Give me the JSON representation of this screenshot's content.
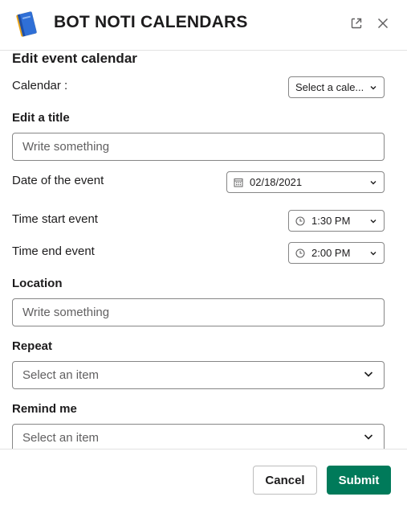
{
  "header": {
    "app_title": "BOT NOTI CALENDARS",
    "app_icon": "notebook-icon",
    "popout_icon": "external-link-icon",
    "close_icon": "close-icon"
  },
  "form": {
    "section_title": "Edit event calendar",
    "calendar": {
      "label": "Calendar :",
      "value": "Select a cale..."
    },
    "title": {
      "label": "Edit a title",
      "placeholder": "Write something"
    },
    "date": {
      "label": "Date of the event",
      "value": "02/18/2021",
      "icon": "calendar-icon"
    },
    "time_start": {
      "label": "Time start event",
      "value": "1:30 PM",
      "icon": "clock-icon"
    },
    "time_end": {
      "label": "Time end event",
      "value": "2:00 PM",
      "icon": "clock-icon"
    },
    "location": {
      "label": "Location",
      "placeholder": "Write something"
    },
    "repeat": {
      "label": "Repeat",
      "value": "Select an item"
    },
    "remind": {
      "label": "Remind me",
      "value": "Select an item"
    }
  },
  "footer": {
    "cancel_label": "Cancel",
    "submit_label": "Submit"
  },
  "colors": {
    "submit_bg": "#007a5a",
    "text": "#1d1c1d",
    "border": "#868686",
    "placeholder": "#616061"
  }
}
